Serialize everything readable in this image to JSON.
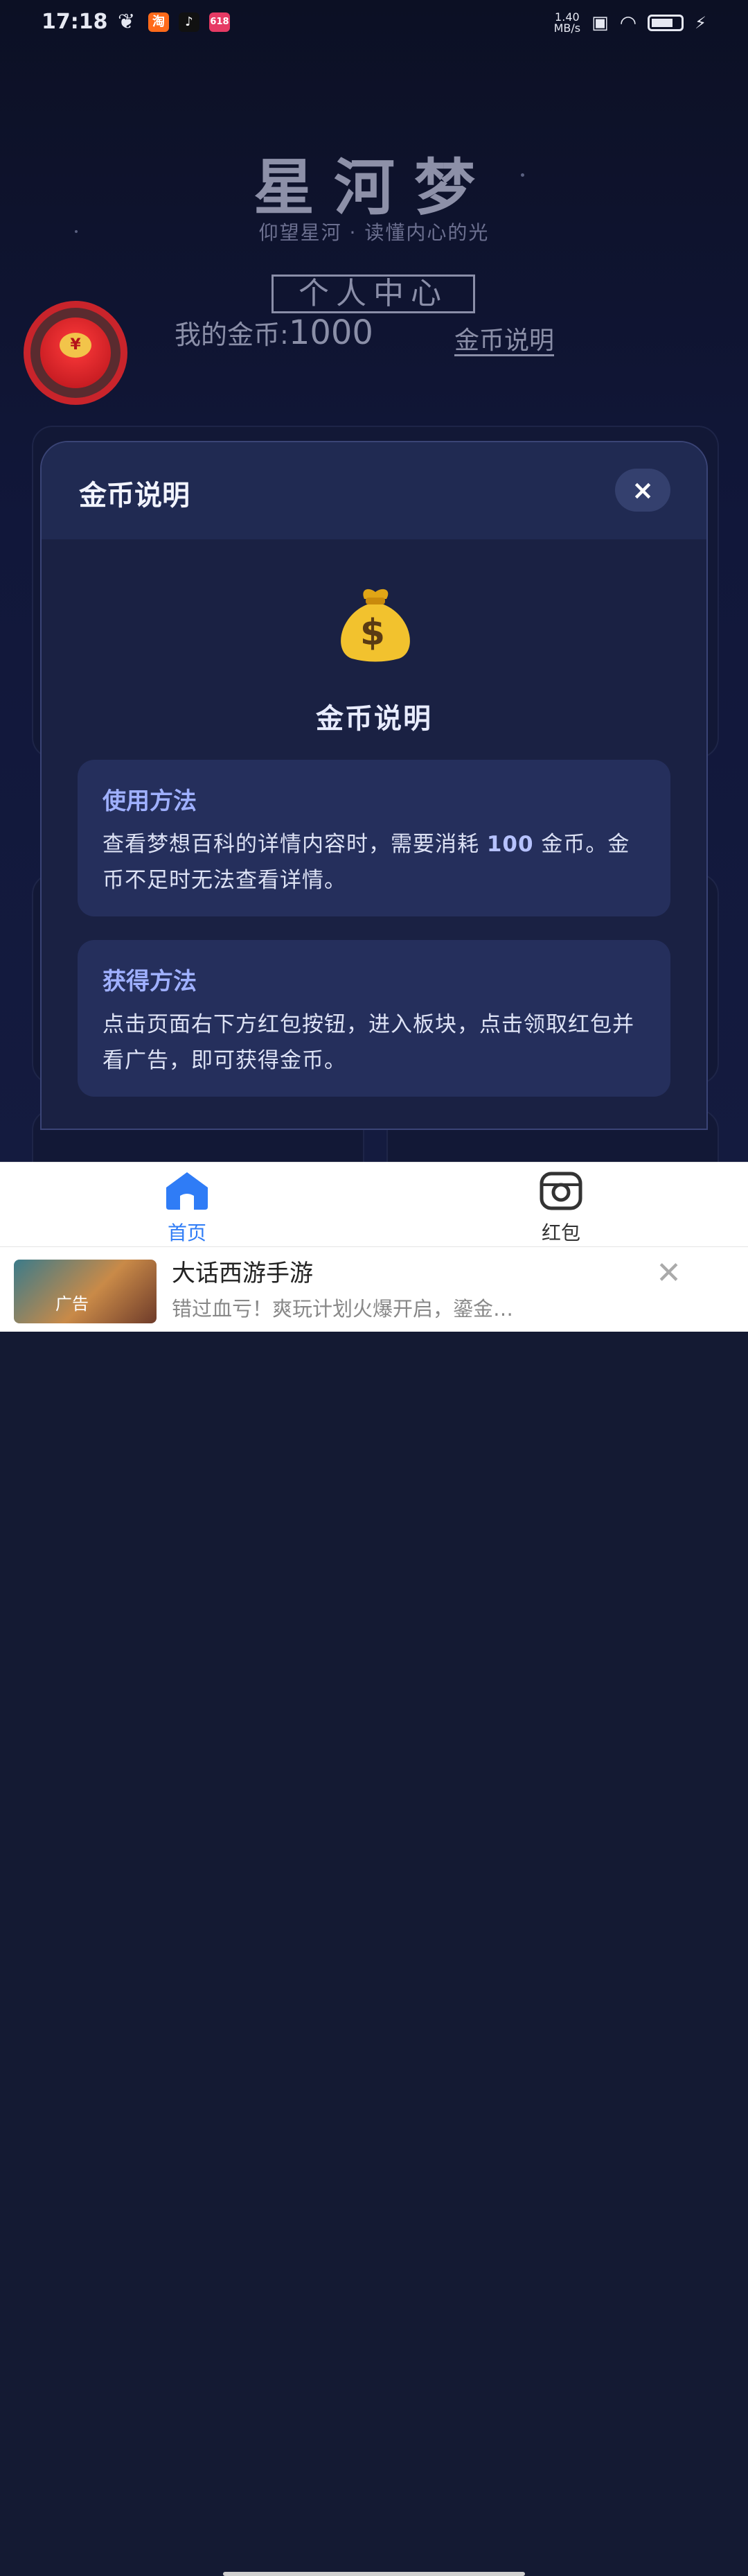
{
  "status_bar": {
    "time": "17:18",
    "net_speed_value": "1.40",
    "net_speed_unit": "MB/s",
    "apps": [
      "taobao-app-icon",
      "tiktok-app-icon",
      "618-app-icon"
    ],
    "app_618_label": "618"
  },
  "brand": {
    "title": "星河梦",
    "subtitle": "仰望星河 · 读懂内心的光"
  },
  "profile": {
    "center_label": "个人中心",
    "coins_label": "我的金币:",
    "coins_value": "1000",
    "coins_explain_link": "金币说明",
    "redpacket_symbol": "¥"
  },
  "modal": {
    "title": "金币说明",
    "close_symbol": "×",
    "heading": "金币说明",
    "usage": {
      "title": "使用方法",
      "text_before": "查看梦想百科的详情内容时，需要消耗 ",
      "highlight": "100",
      "text_after": " 金币。金币不足时无法查看详情。"
    },
    "earn": {
      "title": "获得方法",
      "text": "点击页面右下方红包按钮，进入板块，点击领取红包并看广告，即可获得金币。"
    }
  },
  "tabs": [
    {
      "label": "首页",
      "active": true,
      "icon": "home-icon"
    },
    {
      "label": "红包",
      "active": false,
      "icon": "camera-icon"
    }
  ],
  "ad": {
    "title": "大话西游手游",
    "desc": "错过血亏！爽玩计划火爆开启，鎏金…",
    "thumb_label": "广告",
    "close_symbol": "✕"
  },
  "colors": {
    "accent_blue": "#2f7cf6",
    "modal_bg": "#1b2347",
    "highlight": "#9fb0ff",
    "redpacket": "#c9242b"
  }
}
